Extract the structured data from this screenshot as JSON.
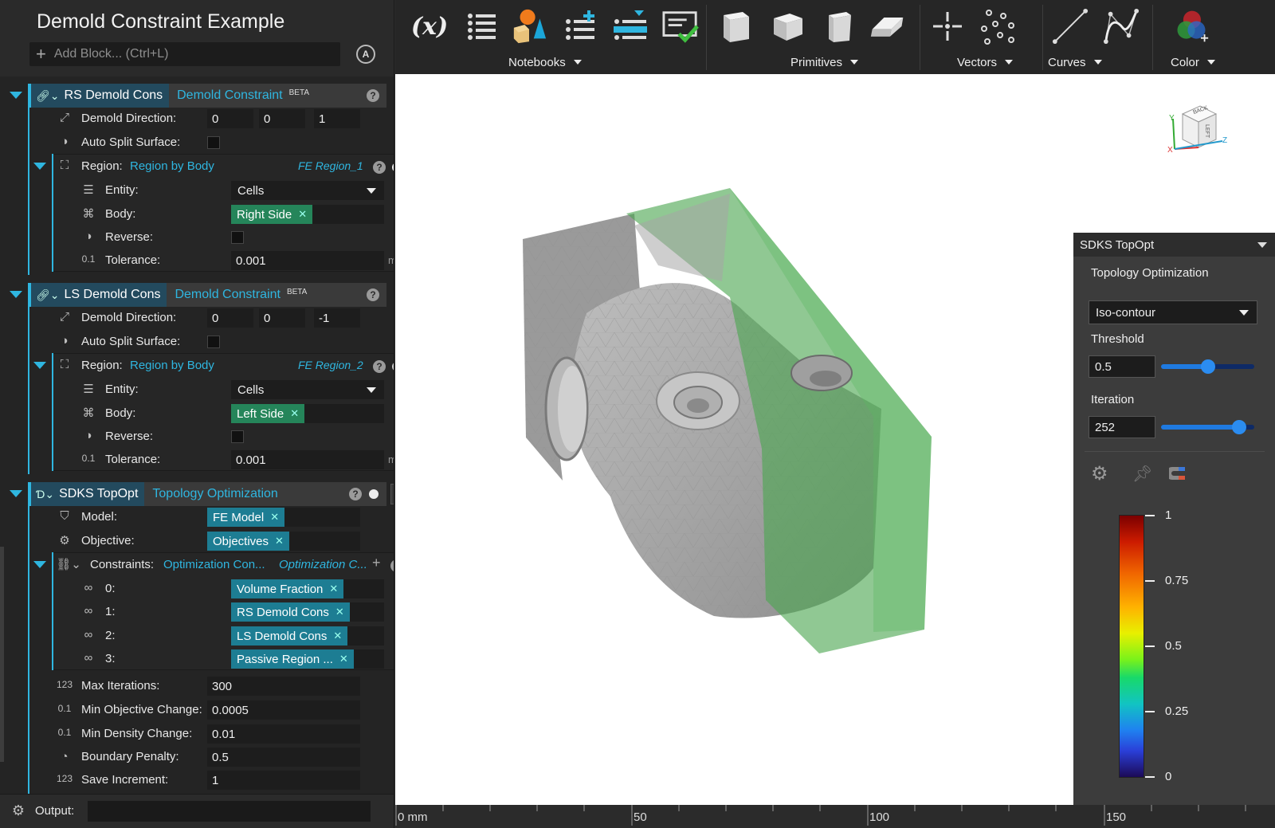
{
  "document": {
    "title": "Demold Constraint Example",
    "add_block_placeholder": "Add Block... (Ctrl+L)"
  },
  "colors": {
    "accent": "#2fb6e0",
    "panel_bg": "#2b2b2b",
    "tag_teal": "#1d7d93",
    "tag_green": "#25855a",
    "mold_green": "#4ca651"
  },
  "blocks": {
    "rs": {
      "name": "RS Demold Cons",
      "type": "Demold Constraint",
      "badge": "BETA",
      "direction_label": "Demold Direction:",
      "dir_x": "0",
      "dir_y": "0",
      "dir_z": "1",
      "auto_split_label": "Auto Split Surface:",
      "region_label": "Region:",
      "region_type": "Region by Body",
      "region_name": "FE Region_1",
      "entity_label": "Entity:",
      "entity_value": "Cells",
      "body_label": "Body:",
      "body_value": "Right Side",
      "reverse_label": "Reverse:",
      "tolerance_label": "Tolerance:",
      "tolerance_value": "0.001",
      "tolerance_unit": "mm"
    },
    "ls": {
      "name": "LS Demold Cons",
      "type": "Demold Constraint",
      "badge": "BETA",
      "direction_label": "Demold Direction:",
      "dir_x": "0",
      "dir_y": "0",
      "dir_z": "-1",
      "auto_split_label": "Auto Split Surface:",
      "region_label": "Region:",
      "region_type": "Region by Body",
      "region_name": "FE Region_2",
      "entity_label": "Entity:",
      "entity_value": "Cells",
      "body_label": "Body:",
      "body_value": "Left Side",
      "reverse_label": "Reverse:",
      "tolerance_label": "Tolerance:",
      "tolerance_value": "0.001",
      "tolerance_unit": "mm"
    },
    "topopt": {
      "name": "SDKS TopOpt",
      "type": "Topology Optimization",
      "model_label": "Model:",
      "model_value": "FE Model",
      "objective_label": "Objective:",
      "objective_value": "Objectives",
      "constraints_label": "Constraints:",
      "constraints_type": "Optimization Con...",
      "constraints_name": "Optimization C...",
      "constraints": [
        {
          "index": "0:",
          "value": "Volume Fraction"
        },
        {
          "index": "1:",
          "value": "RS Demold Cons"
        },
        {
          "index": "2:",
          "value": "LS Demold Cons"
        },
        {
          "index": "3:",
          "value": "Passive Region ..."
        }
      ],
      "max_iter_label": "Max Iterations:",
      "max_iter_value": "300",
      "min_obj_label": "Min Objective Change:",
      "min_obj_value": "0.0005",
      "min_density_label": "Min Density Change:",
      "min_density_value": "0.01",
      "boundary_label": "Boundary Penalty:",
      "boundary_value": "0.5",
      "save_inc_label": "Save Increment:",
      "save_inc_value": "1"
    }
  },
  "output": {
    "label": "Output:"
  },
  "toolbar": {
    "notebooks": "Notebooks",
    "primitives": "Primitives",
    "vectors": "Vectors",
    "curves": "Curves",
    "color": "Color",
    "variable_icon": "(x)"
  },
  "sdks_panel": {
    "title": "SDKS TopOpt",
    "section": "Topology Optimization",
    "mode": "Iso-contour",
    "threshold_label": "Threshold",
    "threshold_value": "0.5",
    "threshold_fraction": 0.5,
    "iteration_label": "Iteration",
    "iteration_value": "252",
    "iteration_fraction": 0.84,
    "colorbar_labels": [
      "1",
      "0.75",
      "0.5",
      "0.25",
      "0"
    ]
  },
  "ruler": {
    "labels": [
      "0 mm",
      "50",
      "100",
      "150"
    ]
  },
  "viewcube": {
    "face_back": "BACK",
    "face_left": "LEFT",
    "axis_y": "Y",
    "axis_x": "X",
    "axis_z": "Z"
  }
}
